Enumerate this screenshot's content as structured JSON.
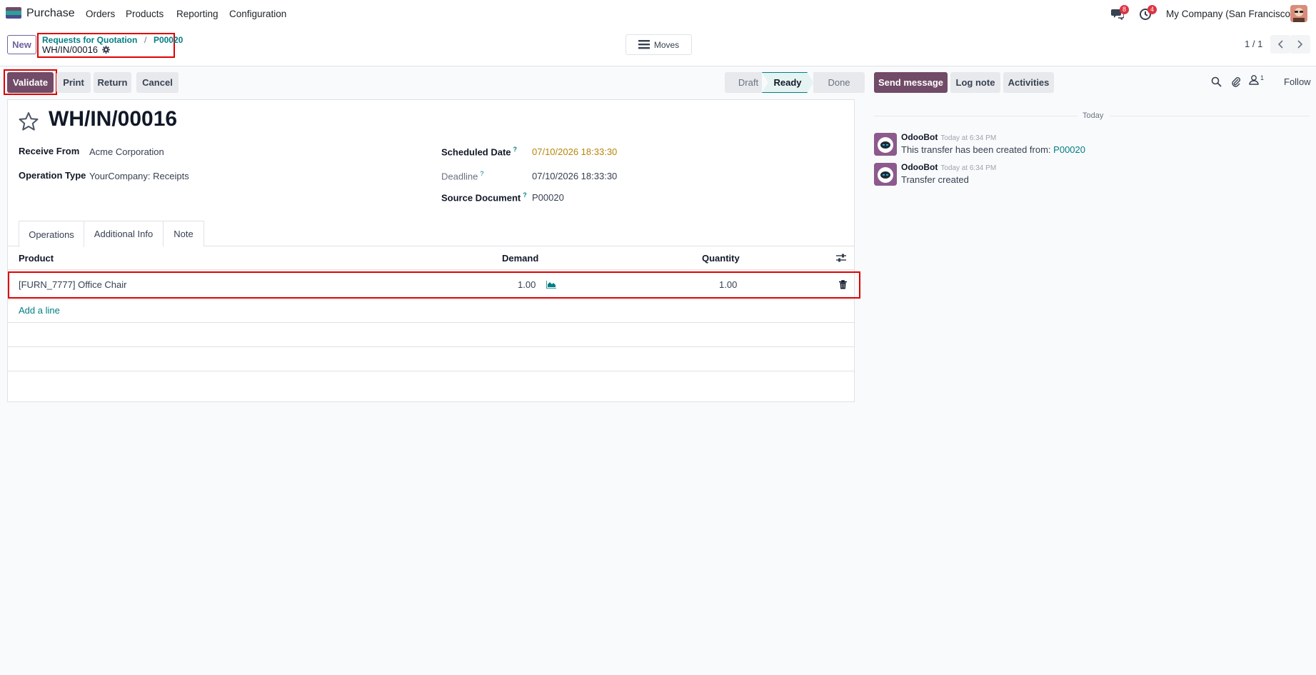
{
  "navbar": {
    "app_name": "Purchase",
    "menu": [
      "Orders",
      "Products",
      "Reporting",
      "Configuration"
    ],
    "messages_count": "8",
    "activities_count": "4",
    "company": "My Company (San Francisco)"
  },
  "control_panel": {
    "new_label": "New",
    "breadcrumb_parent": "Requests for Quotation",
    "breadcrumb_sep": "/",
    "breadcrumb_order": "P00020",
    "record_name": "WH/IN/00016",
    "moves_label": "Moves",
    "pager": "1 / 1"
  },
  "actions": {
    "validate": "Validate",
    "print": "Print",
    "return": "Return",
    "cancel": "Cancel"
  },
  "statusbar": [
    "Draft",
    "Ready",
    "Done"
  ],
  "statusbar_active": "Ready",
  "form": {
    "title": "WH/IN/00016",
    "receive_from_label": "Receive From",
    "receive_from_value": "Acme Corporation",
    "operation_type_label": "Operation Type",
    "operation_type_value": "YourCompany: Receipts",
    "scheduled_date_label": "Scheduled Date",
    "scheduled_date_value": "07/10/2026 18:33:30",
    "deadline_label": "Deadline",
    "deadline_value": "07/10/2026 18:33:30",
    "source_document_label": "Source Document",
    "source_document_value": "P00020",
    "help_mark": "?"
  },
  "tabs": [
    "Operations",
    "Additional Info",
    "Note"
  ],
  "operations": {
    "columns": [
      "Product",
      "Demand",
      "Quantity"
    ],
    "rows": [
      {
        "product": "[FURN_7777] Office Chair",
        "demand": "1.00",
        "quantity": "1.00"
      }
    ],
    "add_line": "Add a line"
  },
  "chatter": {
    "send_message": "Send message",
    "log_note": "Log note",
    "activities": "Activities",
    "followers_count": "1",
    "follow": "Follow",
    "date_separator": "Today",
    "messages": [
      {
        "author": "OdooBot",
        "time": "Today at 6:34 PM",
        "body": "This transfer has been created from:",
        "link": "P00020"
      },
      {
        "author": "OdooBot",
        "time": "Today at 6:34 PM",
        "body": "Transfer created",
        "link": ""
      }
    ]
  },
  "colors": {
    "brand": "#714b67",
    "link": "#017e84",
    "highlight_box": "#e00000",
    "scheduled_date": "#b7860b"
  }
}
